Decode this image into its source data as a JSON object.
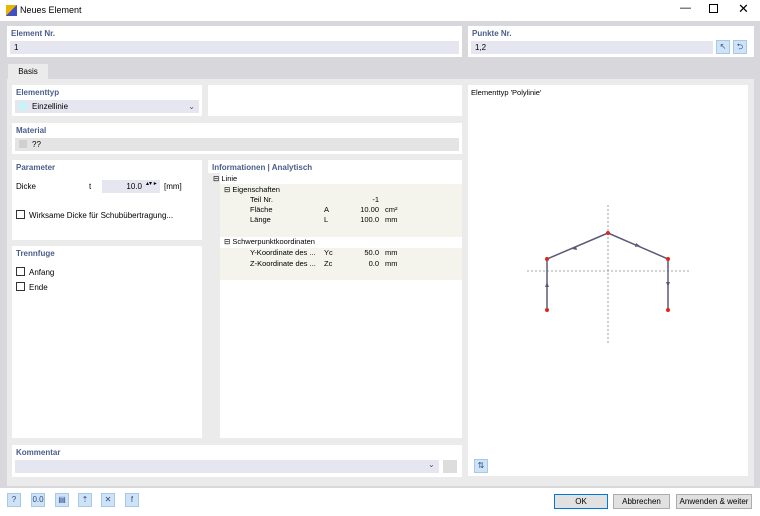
{
  "window": {
    "title": "Neues Element"
  },
  "element_nr": {
    "label": "Element Nr.",
    "value": "1"
  },
  "punkte_nr": {
    "label": "Punkte Nr.",
    "value": "1,2"
  },
  "tabs": [
    {
      "label": "Basis"
    }
  ],
  "elementtyp": {
    "label": "Elementtyp",
    "value": "Einzellinie",
    "swatch": "#c8f4f8"
  },
  "material": {
    "label": "Material",
    "value": "??"
  },
  "parameter": {
    "label": "Parameter",
    "dicke_label": "Dicke",
    "dicke_symbol": "t",
    "dicke_value": "10.0",
    "dicke_unit": "[mm]",
    "checkbox_label": "Wirksame Dicke für Schubübertragung...",
    "checkbox_checked": false
  },
  "trennfuge": {
    "label": "Trennfuge",
    "items": [
      {
        "label": "Anfang",
        "checked": false
      },
      {
        "label": "Ende",
        "checked": false
      }
    ]
  },
  "info": {
    "label": "Informationen | Analytisch",
    "root": "Linie",
    "groups": [
      {
        "title": "Eigenschaften",
        "rows": [
          {
            "name": "Teil Nr.",
            "symbol": "",
            "value": "-1",
            "unit": ""
          },
          {
            "name": "Fläche",
            "symbol": "A",
            "value": "10.00",
            "unit": "cm²"
          },
          {
            "name": "Länge",
            "symbol": "L",
            "value": "100.0",
            "unit": "mm"
          }
        ]
      },
      {
        "title": "Schwerpunktkoordinaten",
        "rows": [
          {
            "name": "Y-Koordinate des ...",
            "symbol": "Yc",
            "value": "50.0",
            "unit": "mm"
          },
          {
            "name": "Z-Koordinate des ...",
            "symbol": "Zc",
            "value": "0.0",
            "unit": "mm"
          }
        ]
      }
    ]
  },
  "preview": {
    "title": "Elementtyp 'Polylinie'",
    "line_color": "#5a5a78",
    "point_color": "#e0261b"
  },
  "kommentar": {
    "label": "Kommentar",
    "value": ""
  },
  "buttons": {
    "ok": "OK",
    "cancel": "Abbrechen",
    "apply": "Anwenden & weiter"
  },
  "accent": "#0078d7"
}
